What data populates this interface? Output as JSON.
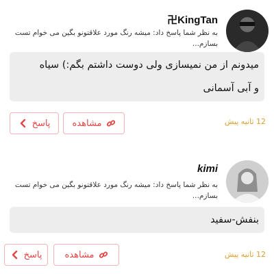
{
  "comments": [
    {
      "username": "卍KingTan",
      "reply_ref": "به نظر شما پاسخ داد: میشه رنگ مورد علاقتونو بگین می خوام تست بسازم...",
      "text_lines": [
        "میدونم از من نمیسازی ولی دوست داشتم بگم:) سیاه",
        "و آبی آسمانی"
      ],
      "view_label": "مشاهده",
      "reply_label": "پاسخ",
      "time": "12 ثانیه پیش"
    },
    {
      "username": "kimi",
      "reply_ref": "به نظر شما پاسخ داد: میشه رنگ مورد علاقتونو بگین می خوام تست بسازم...",
      "text_lines": [
        "بنفش-سفید"
      ],
      "view_label": "مشاهده",
      "reply_label": "پاسخ",
      "time": "12 ثانیه پیش"
    }
  ],
  "colors": {
    "accent": "#e44545",
    "border": "#f0b4b4",
    "time": "#d9a02b",
    "bubble": "#ededed"
  },
  "icons": {
    "view": "link-icon",
    "reply": "chevron-left-icon"
  }
}
